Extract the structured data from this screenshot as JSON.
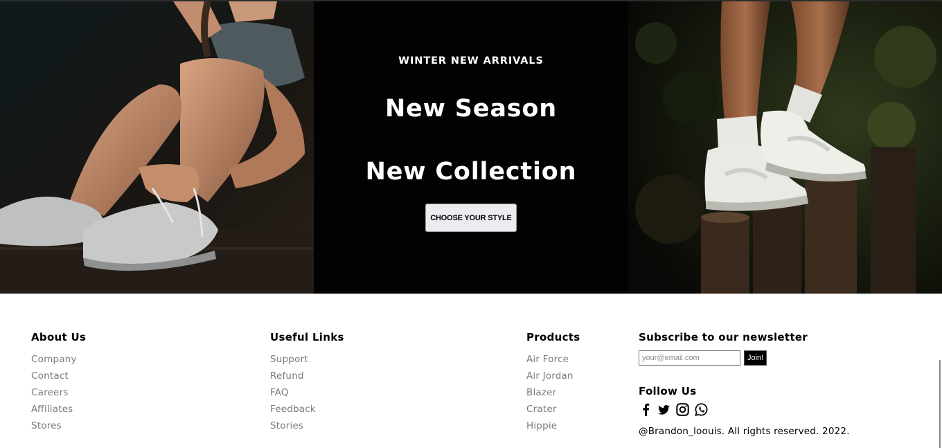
{
  "hero": {
    "eyebrow": "WINTER NEW ARRIVALS",
    "headline_1": "New Season",
    "headline_2": "New Collection",
    "cta_label": "CHOOSE YOUR STYLE",
    "left_image": "woman tying white sneaker laces (photo)",
    "right_image": "legs in white high-top sneakers stepping on wooden posts (photo)"
  },
  "footer": {
    "about": {
      "title": "About Us",
      "links": [
        "Company",
        "Contact",
        "Careers",
        "Affiliates",
        "Stores"
      ]
    },
    "useful": {
      "title": "Useful Links",
      "links": [
        "Support",
        "Refund",
        "FAQ",
        "Feedback",
        "Stories"
      ]
    },
    "products": {
      "title": "Products",
      "links": [
        "Air Force",
        "Air Jordan",
        "Blazer",
        "Crater",
        "Hippie"
      ]
    },
    "newsletter": {
      "title": "Subscribe to our newsletter",
      "placeholder": "your@email.com",
      "value": "",
      "join_label": "Join!"
    },
    "follow": {
      "title": "Follow Us",
      "icons": [
        "facebook-icon",
        "twitter-icon",
        "instagram-icon",
        "whatsapp-icon"
      ]
    },
    "copyright": "@Brandon_loouis. All rights reserved. 2022."
  },
  "colors": {
    "hero_bg": "#020202",
    "button_bg": "#ececf0",
    "link_gray": "#7a7a7a",
    "text": "#000000"
  }
}
